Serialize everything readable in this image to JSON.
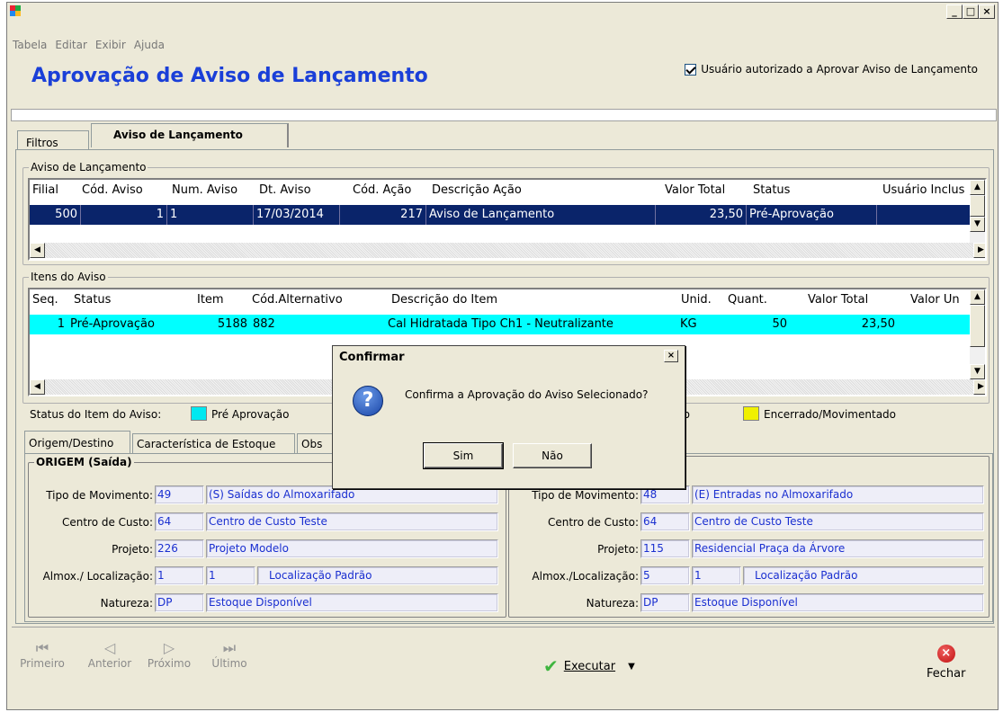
{
  "window": {
    "minimize": "_",
    "maximize": "□",
    "close": "×"
  },
  "menu": [
    "Tabela",
    "Editar",
    "Exibir",
    "Ajuda"
  ],
  "header": {
    "title": "Aprovação de Aviso de Lançamento",
    "auth_label": "Usuário autorizado a Aprovar Aviso de Lançamento",
    "auth_checked": true
  },
  "tabs": [
    {
      "label": "Filtros"
    },
    {
      "label": "Aviso de Lançamento"
    }
  ],
  "aviso": {
    "legend": "Aviso de Lançamento",
    "columns": [
      "Filial",
      "Cód. Aviso",
      "Num. Aviso",
      "Dt. Aviso",
      "Cód. Ação",
      "Descrição Ação",
      "Valor Total",
      "Status",
      "Usuário Inclus"
    ],
    "rows": [
      [
        "500",
        "1",
        "1",
        "17/03/2014",
        "217",
        "Aviso de Lançamento",
        "23,50",
        "Pré-Aprovação",
        ""
      ]
    ]
  },
  "itens": {
    "legend": "Itens do Aviso",
    "columns": [
      "Seq.",
      "Status",
      "Item",
      "Cód.Alternativo",
      "Descrição do Item",
      "Unid.",
      "Quant.",
      "Valor Total",
      "Valor Un"
    ],
    "rows": [
      [
        "1",
        "Pré-Aprovação",
        "5188",
        "882",
        "Cal Hidratada Tipo Ch1 - Neutralizante",
        "KG",
        "50",
        "23,50",
        ""
      ]
    ]
  },
  "status_legend": {
    "label": "Status do Item do Aviso:",
    "items": [
      {
        "label": "Pré Aprovação",
        "color": "#00e8f0"
      },
      {
        "label": "do",
        "color": ""
      },
      {
        "label": "Encerrado/Movimentado",
        "color": "#f0f000"
      }
    ]
  },
  "subtabs": [
    "Origem/Destino",
    "Característica de Estoque",
    "Obs"
  ],
  "origem": {
    "legend": "ORIGEM (Saída)",
    "tipo_label": "Tipo de Movimento:",
    "tipo_code": "49",
    "tipo_desc": "(S) Saídas do Almoxarifado",
    "cc_label": "Centro de Custo:",
    "cc_code": "64",
    "cc_desc": "Centro de Custo Teste",
    "proj_label": "Projeto:",
    "proj_code": "226",
    "proj_desc": "Projeto Modelo",
    "almox_label": "Almox./ Localização:",
    "almox_code": "1",
    "loc_code": "1",
    "loc_desc": "Localização Padrão",
    "nat_label": "Natureza:",
    "nat_code": "DP",
    "nat_desc": "Estoque Disponível"
  },
  "destino": {
    "tipo_label": "Tipo de Movimento:",
    "tipo_code": "48",
    "tipo_desc": "(E) Entradas no Almoxarifado",
    "cc_label": "Centro de Custo:",
    "cc_code": "64",
    "cc_desc": "Centro de Custo Teste",
    "proj_label": "Projeto:",
    "proj_code": "115",
    "proj_desc": "Residencial Praça da Árvore",
    "almox_label": "Almox./Localização:",
    "almox_code": "5",
    "loc_code": "1",
    "loc_desc": "Localização Padrão",
    "nat_label": "Natureza:",
    "nat_code": "DP",
    "nat_desc": "Estoque Disponível"
  },
  "nav": {
    "first": "Primeiro",
    "prev": "Anterior",
    "next": "Próximo",
    "last": "Último"
  },
  "actions": {
    "execute": "Executar",
    "close": "Fechar"
  },
  "dialog": {
    "title": "Confirmar",
    "message": "Confirma a Aprovação do Aviso Selecionado?",
    "yes": "Sim",
    "no": "Não",
    "close": "×"
  }
}
